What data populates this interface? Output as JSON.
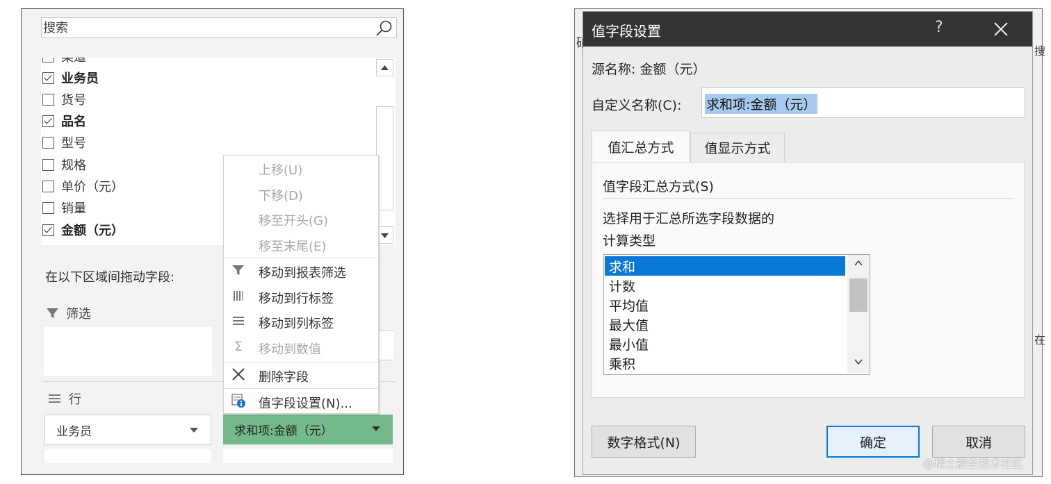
{
  "left_panel": {
    "search_placeholder": "搜索",
    "fields": [
      {
        "label": "渠道",
        "checked": false,
        "bold": false
      },
      {
        "label": "业务员",
        "checked": true,
        "bold": true
      },
      {
        "label": "货号",
        "checked": false,
        "bold": false
      },
      {
        "label": "品名",
        "checked": true,
        "bold": true
      },
      {
        "label": "型号",
        "checked": false,
        "bold": false
      },
      {
        "label": "规格",
        "checked": false,
        "bold": false
      },
      {
        "label": "单价（元）",
        "checked": false,
        "bold": false
      },
      {
        "label": "销量",
        "checked": false,
        "bold": false
      },
      {
        "label": "金额（元）",
        "checked": true,
        "bold": true
      }
    ],
    "drag_hint": "在以下区域间拖动字段:",
    "filter_label": "筛选",
    "row_label": "行",
    "row_field": "业务员",
    "value_field": "求和项:金额（元）"
  },
  "context_menu": {
    "items": [
      {
        "label": "上移(U)",
        "enabled": false,
        "icon": ""
      },
      {
        "label": "下移(D)",
        "enabled": false,
        "icon": ""
      },
      {
        "label": "移至开头(G)",
        "enabled": false,
        "icon": ""
      },
      {
        "label": "移至末尾(E)",
        "enabled": false,
        "icon": ""
      },
      {
        "label": "移动到报表筛选",
        "enabled": true,
        "icon": "filter-icon"
      },
      {
        "label": "移动到行标签",
        "enabled": true,
        "icon": "row-labels-icon"
      },
      {
        "label": "移动到列标签",
        "enabled": true,
        "icon": "column-labels-icon"
      },
      {
        "label": "移动到数值",
        "enabled": false,
        "icon": "sigma-icon"
      },
      {
        "label": "删除字段",
        "enabled": true,
        "icon": "delete-icon"
      },
      {
        "label": "值字段设置(N)...",
        "enabled": true,
        "icon": "field-settings-icon"
      }
    ]
  },
  "dialog": {
    "title": "值字段设置",
    "help": "?",
    "source_label": "源名称:  金额（元）",
    "custom_label": "自定义名称(C):",
    "custom_name": "求和项:金额（元）",
    "tabs": [
      "值汇总方式",
      "值显示方式"
    ],
    "summarize_heading": "值字段汇总方式(S)",
    "desc_line1": "选择用于汇总所选字段数据的",
    "desc_line2": "计算类型",
    "calc_types": [
      "求和",
      "计数",
      "平均值",
      "最大值",
      "最小值",
      "乘积"
    ],
    "selected_calc": "求和",
    "number_format_btn": "数字格式(N)",
    "ok_btn": "确定",
    "cancel_btn": "取消"
  },
  "background_fragments": {
    "a": "砶",
    "b": "搜",
    "c": "在"
  },
  "watermark": "@稀土掘金技术社区",
  "colors": {
    "value_chip": "#74b98c",
    "selection": "#0a78d7",
    "titlebar": "#333333"
  }
}
